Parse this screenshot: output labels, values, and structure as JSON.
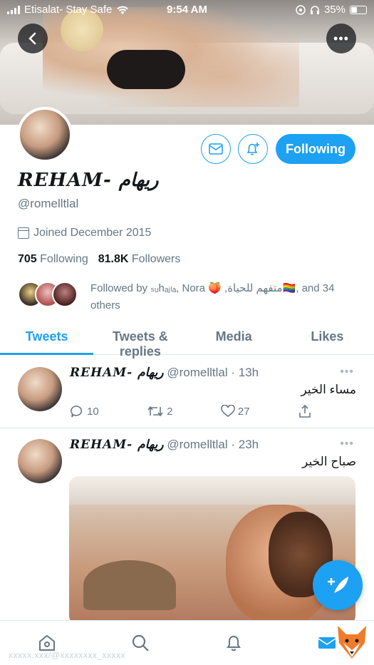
{
  "status_bar": {
    "carrier": "Etisalat- Stay Safe",
    "time": "9:54 AM",
    "battery": "35%",
    "battery_fraction": 0.35
  },
  "profile": {
    "display_name": "REHAM- ريهام",
    "handle": "@romelltlal",
    "joined": "Joined December 2015",
    "following_count": "705",
    "following_label": "Following",
    "followers_count": "81.8K",
    "followers_label": "Followers",
    "followed_by": "Followed by ₛᵤhₐⱼₗₐ, Nora 🍑 ,متفهم للحياة🏳️‍🌈, and 34 others",
    "follow_button_label": "Following"
  },
  "tabs": [
    "Tweets",
    "Tweets & replies",
    "Media",
    "Likes"
  ],
  "active_tab": "Tweets",
  "tweets": [
    {
      "name": "REHAM- ريهام",
      "handle": "@romelltlal",
      "time": "· 13h",
      "text": "مساء الخير",
      "replies": "10",
      "retweets": "2",
      "likes": "27"
    },
    {
      "name": "REHAM- ريهام",
      "handle": "@romelltlal",
      "time": "· 23h",
      "text": "صباح الخير"
    }
  ],
  "watermark": "xxxxx.xxx/@xxxxxxxx_xxxxx",
  "accent_color": "#1da1f2",
  "icons": {
    "back": "chevron-left-icon",
    "more": "more-icon",
    "dm": "envelope-icon",
    "notify": "bell-plus-icon",
    "compose": "feather-plus-icon",
    "nav": [
      "home-icon",
      "search-icon",
      "bell-icon",
      "mail-icon"
    ]
  }
}
